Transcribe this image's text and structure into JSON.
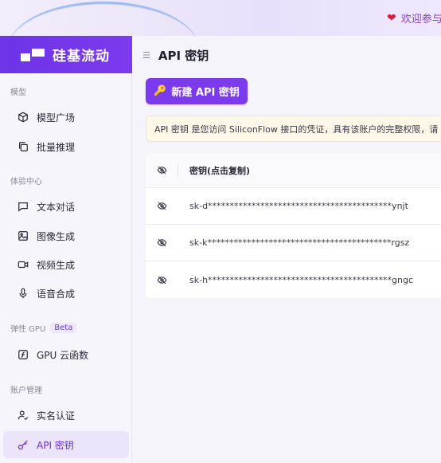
{
  "header": {
    "welcome": "欢迎参与"
  },
  "sidebar": {
    "logo_text": "硅基流动",
    "sections": [
      {
        "label": "模型",
        "items": [
          {
            "label": "模型广场",
            "icon": "cube-icon"
          },
          {
            "label": "批量推理",
            "icon": "copy-icon"
          }
        ]
      },
      {
        "label": "体验中心",
        "items": [
          {
            "label": "文本对话",
            "icon": "chat-icon"
          },
          {
            "label": "图像生成",
            "icon": "image-icon"
          },
          {
            "label": "视频生成",
            "icon": "video-icon"
          },
          {
            "label": "语音合成",
            "icon": "mic-icon"
          }
        ]
      },
      {
        "label": "弹性 GPU",
        "badge": "Beta",
        "items": [
          {
            "label": "GPU 云函数",
            "icon": "function-icon"
          }
        ]
      },
      {
        "label": "账户管理",
        "items": [
          {
            "label": "实名认证",
            "icon": "user-check-icon"
          },
          {
            "label": "API 密钥",
            "icon": "key-icon",
            "active": true
          }
        ]
      }
    ]
  },
  "main": {
    "title": "API 密钥",
    "new_button": "新建 API 密钥",
    "notice": "API 密钥 是您访问 SiliconFlow 接口的凭证，具有该账户的完整权限，请",
    "table": {
      "header_key": "密钥(点击复制)",
      "rows": [
        {
          "key": "sk-d******************************************ynjt"
        },
        {
          "key": "sk-k******************************************rgsz"
        },
        {
          "key": "sk-h******************************************gngc"
        }
      ]
    }
  },
  "colors": {
    "accent": "#7c3aed",
    "active_bg": "#ebe4fb",
    "notice_bg": "#fff8e8"
  }
}
